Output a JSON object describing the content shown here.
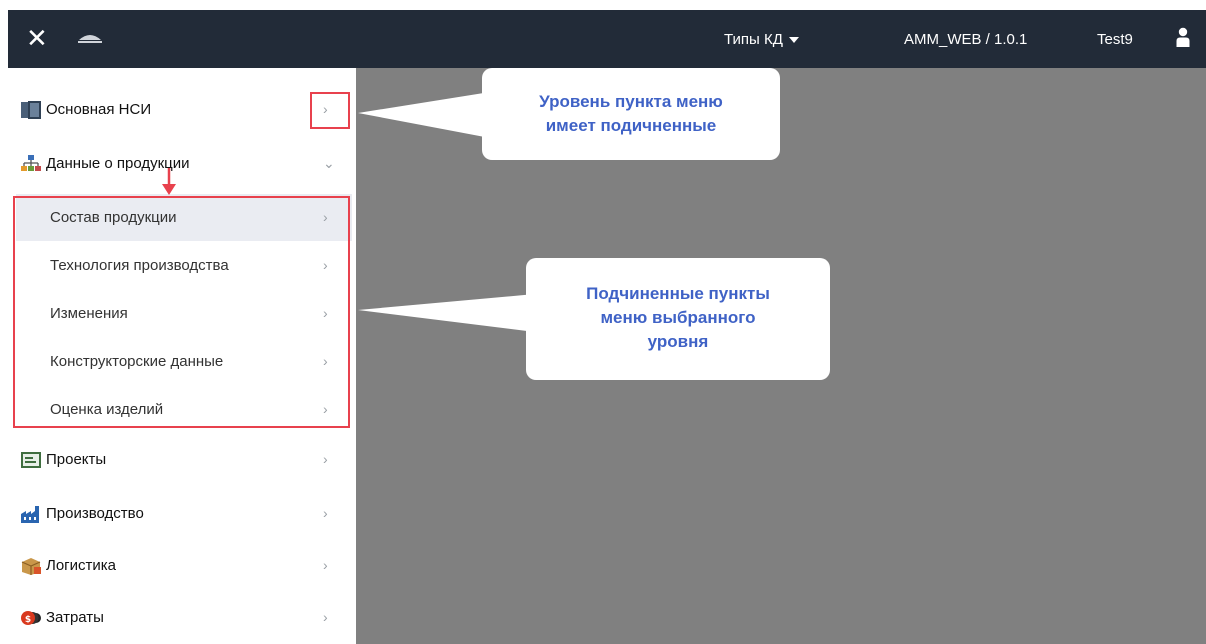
{
  "header": {
    "close_glyph": "✕",
    "logo_icon": "company-logo",
    "types_label": "Типы КД",
    "version": "AMM_WEB / 1.0.1",
    "user": "Test9",
    "user_icon": "user-icon"
  },
  "sidebar": {
    "items": [
      {
        "label": "Основная НСИ",
        "icon": "book-icon",
        "chevron": "›"
      },
      {
        "label": "Данные о продукции",
        "icon": "hierarchy-icon",
        "chevron": "⌄"
      },
      {
        "label": "Проекты",
        "icon": "project-icon",
        "chevron": "›"
      },
      {
        "label": "Производство",
        "icon": "factory-icon",
        "chevron": "›"
      },
      {
        "label": "Логистика",
        "icon": "box-icon",
        "chevron": "›"
      },
      {
        "label": "Затраты",
        "icon": "coins-icon",
        "chevron": "›"
      }
    ],
    "subitems": [
      {
        "label": "Состав продукции",
        "chevron": "›",
        "selected": true
      },
      {
        "label": "Технология производства",
        "chevron": "›"
      },
      {
        "label": "Изменения",
        "chevron": "›"
      },
      {
        "label": "Конструкторские данные",
        "chevron": "›"
      },
      {
        "label": "Оценка изделий",
        "chevron": "›"
      }
    ]
  },
  "callouts": {
    "top_line1": "Уровень пункта меню",
    "top_line2": "имеет подичненные",
    "bottom_line1": "Подчиненные пункты",
    "bottom_line2": "меню выбранного",
    "bottom_line3": "уровня"
  },
  "colors": {
    "header_bg": "#222b38",
    "main_bg": "#808080",
    "highlight": "#e8414d",
    "callout_text": "#3f62c6",
    "selected_bg": "#eaecf2"
  }
}
